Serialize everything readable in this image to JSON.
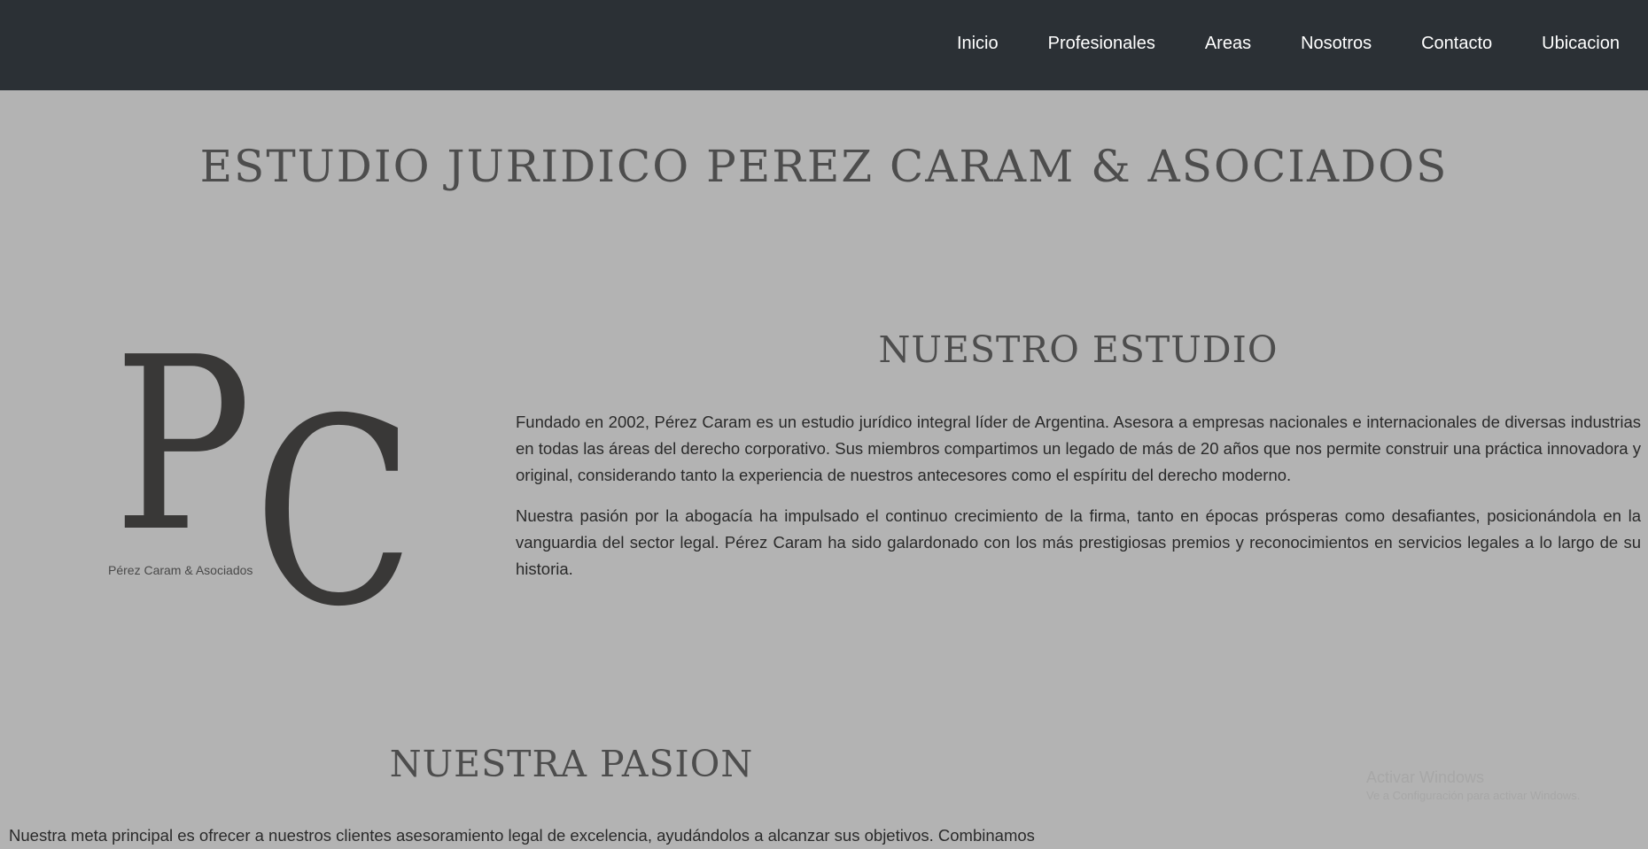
{
  "nav": {
    "items": [
      {
        "label": "Inicio"
      },
      {
        "label": "Profesionales"
      },
      {
        "label": "Areas"
      },
      {
        "label": "Nosotros"
      },
      {
        "label": "Contacto"
      },
      {
        "label": "Ubicacion"
      }
    ]
  },
  "header": {
    "title": "ESTUDIO JURIDICO PEREZ CARAM & ASOCIADOS"
  },
  "logo": {
    "letter_p": "P",
    "letter_c": "C",
    "caption": "Pérez Caram & Asociados"
  },
  "estudio": {
    "heading": "NUESTRO ESTUDIO",
    "paragraphs": [
      "Fundado en 2002, Pérez Caram es un estudio jurídico integral líder de Argentina. Asesora a empresas nacionales e internacionales de diversas industrias en todas las áreas del derecho corporativo. Sus miembros compartimos un legado de más de 20 años que nos permite construir una práctica innovadora y original, considerando tanto la experiencia de nuestros antecesores como el espíritu del derecho moderno.",
      "Nuestra pasión por la abogacía ha impulsado el continuo crecimiento de la firma, tanto en épocas prósperas como desafiantes, posicionándola en la vanguardia del sector legal. Pérez Caram ha sido galardonado con los más prestigiosas premios y reconocimientos en servicios legales a lo largo de su historia."
    ]
  },
  "pasion": {
    "heading": "NUESTRA PASION",
    "text": "Nuestra meta principal es ofrecer a nuestros clientes asesoramiento legal de excelencia, ayudándolos a alcanzar sus objetivos. Combinamos"
  },
  "watermark": {
    "title": "Activar Windows",
    "subtitle": "Ve a Configuración para activar Windows."
  },
  "colors": {
    "navbar_bg": "#2b3035",
    "page_bg": "#b3b3b3",
    "heading": "#4d4d4d",
    "logo": "#393837"
  }
}
